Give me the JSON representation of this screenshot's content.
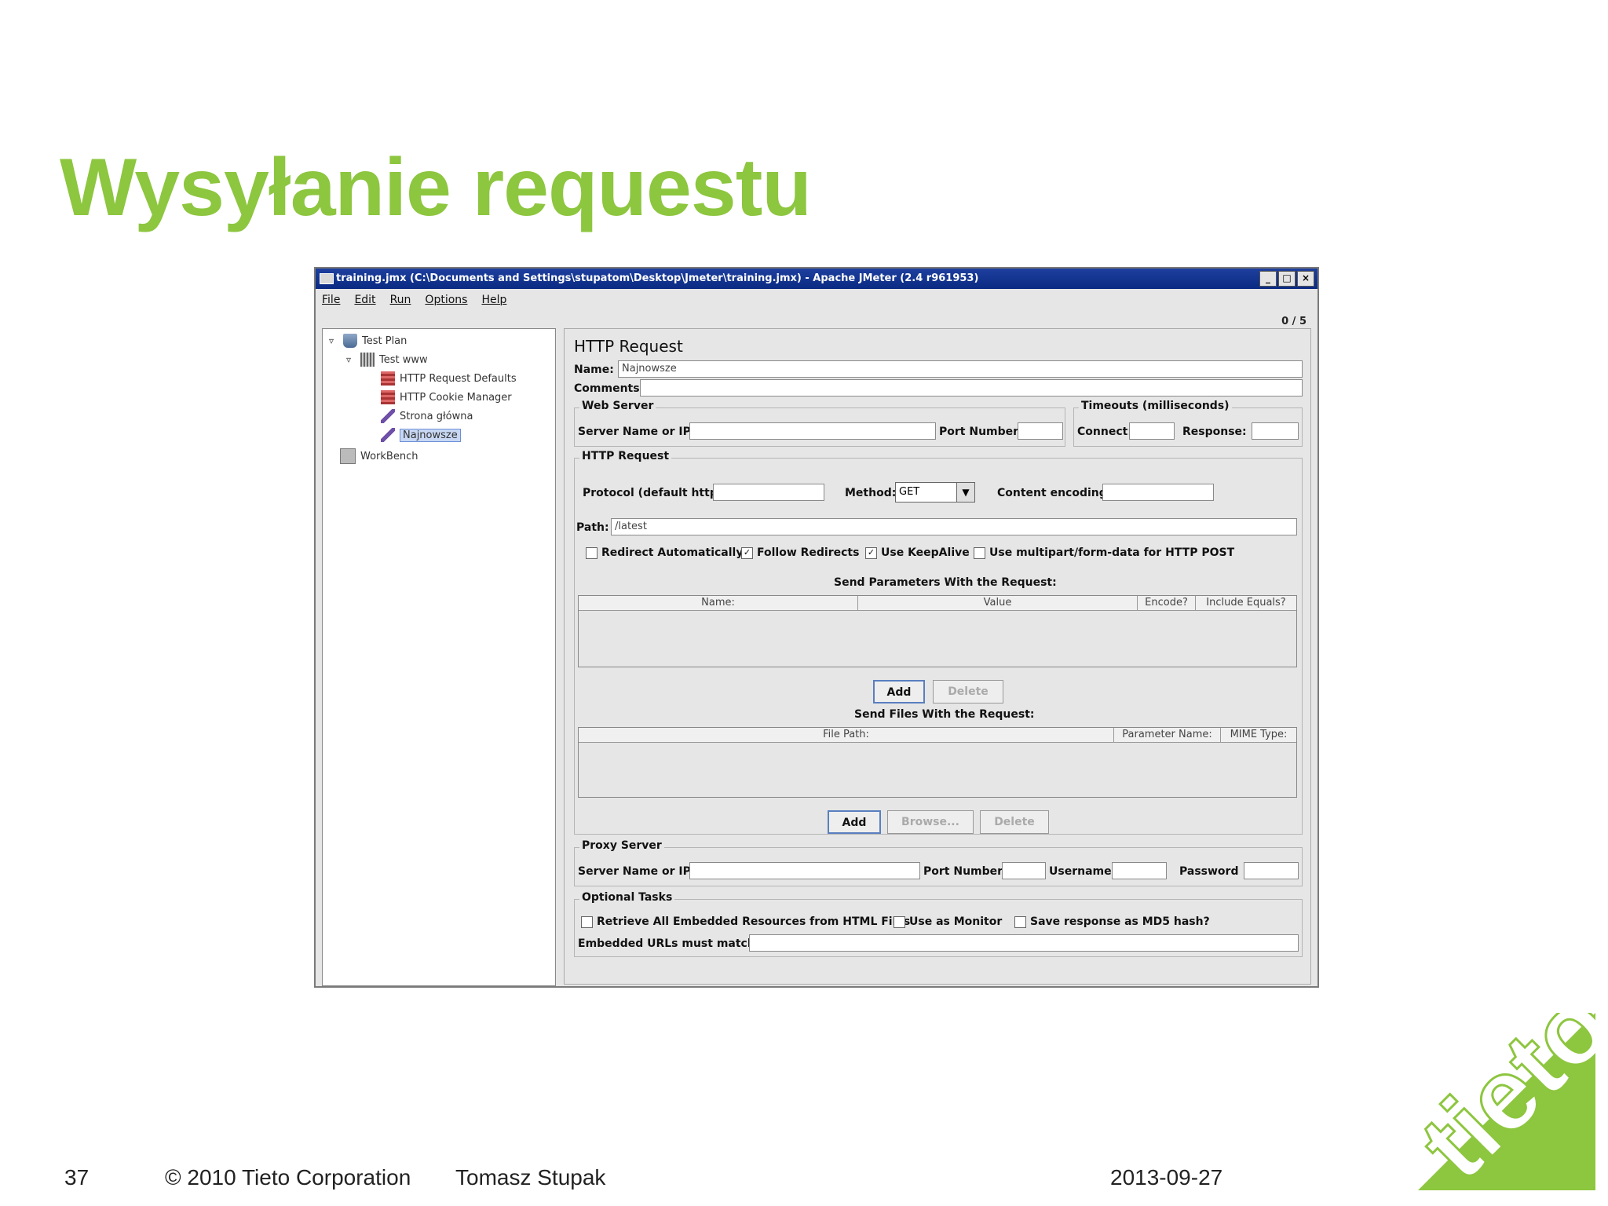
{
  "slide": {
    "title": "Wysyłanie requestu",
    "page_number": "37",
    "copyright": "© 2010 Tieto Corporation",
    "author": "Tomasz Stupak",
    "date": "2013-09-27",
    "logo_text": "tieto"
  },
  "window": {
    "title": "training.jmx (C:\\Documents and Settings\\stupatom\\Desktop\\Jmeter\\training.jmx) - Apache JMeter (2.4 r961953)",
    "controls": [
      "_",
      "□",
      "×"
    ],
    "menu": [
      "File",
      "Edit",
      "Run",
      "Options",
      "Help"
    ],
    "counter": "0 / 5"
  },
  "tree": {
    "test_plan": "Test Plan",
    "thread_group": "Test www",
    "items": [
      "HTTP Request Defaults",
      "HTTP Cookie Manager",
      "Strona główna",
      "Najnowsze"
    ],
    "workbench": "WorkBench"
  },
  "form": {
    "heading": "HTTP Request",
    "name_label": "Name:",
    "name_value": "Najnowsze",
    "comments_label": "Comments:",
    "web_server": {
      "title": "Web Server",
      "server_label": "Server Name or IP:",
      "port_label": "Port Number:"
    },
    "timeouts": {
      "title": "Timeouts (milliseconds)",
      "connect_label": "Connect:",
      "response_label": "Response:"
    },
    "http_request": {
      "title": "HTTP Request",
      "protocol_label": "Protocol (default http):",
      "method_label": "Method:",
      "method_value": "GET",
      "encoding_label": "Content encoding:",
      "path_label": "Path:",
      "path_value": "/latest",
      "redirect_auto": "Redirect Automatically",
      "follow_redirects": "Follow Redirects",
      "keepalive": "Use KeepAlive",
      "multipart": "Use multipart/form-data for HTTP POST",
      "params_title": "Send Parameters With the Request:",
      "params_columns": [
        "Name:",
        "Value",
        "Encode?",
        "Include Equals?"
      ],
      "add": "Add",
      "delete": "Delete",
      "files_title": "Send Files With the Request:",
      "files_columns": [
        "File Path:",
        "Parameter Name:",
        "MIME Type:"
      ],
      "browse": "Browse..."
    },
    "proxy": {
      "title": "Proxy Server",
      "server_label": "Server Name or IP:",
      "port_label": "Port Number:",
      "username_label": "Username",
      "password_label": "Password"
    },
    "optional": {
      "title": "Optional Tasks",
      "retrieve": "Retrieve All Embedded Resources from HTML Files",
      "monitor": "Use as Monitor",
      "md5": "Save response as MD5 hash?",
      "embedded_label": "Embedded URLs must match:"
    }
  },
  "colors": {
    "accent": "#8dc63f",
    "titlebar": "#0a2a82"
  }
}
